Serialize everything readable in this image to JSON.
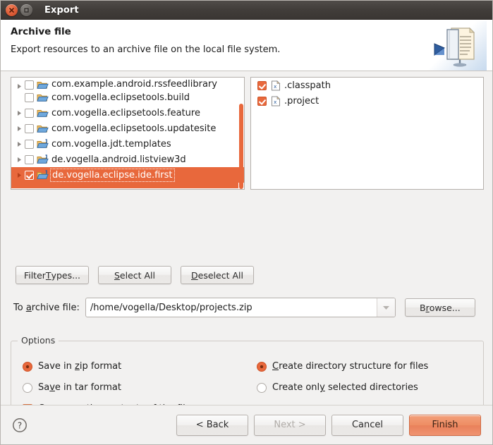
{
  "window": {
    "title": "Export",
    "close_icon": "close-icon",
    "maximize_icon": "maximize-icon"
  },
  "banner": {
    "title": "Archive file",
    "description": "Export resources to an archive file on the local file system.",
    "icon": "export-archive-banner-icon"
  },
  "resource_tree": {
    "scrollbar_color": "#e8683c",
    "selection_color": "#e8683c",
    "items": [
      {
        "label": "com.example.android.rssfeedlibrary",
        "checked": false,
        "expandable": true,
        "selected": false,
        "icon": "folder-icon",
        "clipped": true
      },
      {
        "label": "com.vogella.eclipsetools.build",
        "checked": false,
        "expandable": false,
        "selected": false,
        "icon": "folder-icon",
        "clipped": false
      },
      {
        "label": "com.vogella.eclipsetools.feature",
        "checked": false,
        "expandable": true,
        "selected": false,
        "icon": "folder-icon",
        "clipped": false
      },
      {
        "label": "com.vogella.eclipsetools.updatesite",
        "checked": false,
        "expandable": true,
        "selected": false,
        "icon": "folder-icon",
        "clipped": false
      },
      {
        "label": "com.vogella.jdt.templates",
        "checked": false,
        "expandable": true,
        "selected": false,
        "icon": "java-folder-icon",
        "clipped": false
      },
      {
        "label": "de.vogella.android.listview3d",
        "checked": false,
        "expandable": true,
        "selected": false,
        "icon": "java-folder-icon",
        "clipped": false
      },
      {
        "label": "de.vogella.eclipse.ide.first",
        "checked": true,
        "expandable": true,
        "selected": true,
        "icon": "java-folder-icon",
        "clipped": false
      }
    ]
  },
  "resource_files": {
    "items": [
      {
        "label": ".classpath",
        "checked": true,
        "icon": "xml-file-icon"
      },
      {
        "label": ".project",
        "checked": true,
        "icon": "xml-file-icon"
      }
    ]
  },
  "filter_buttons": [
    {
      "name": "filter-types-button",
      "pre": "Filter ",
      "mnemonic": "T",
      "post": "ypes..."
    },
    {
      "name": "select-all-button",
      "pre": "",
      "mnemonic": "S",
      "post": "elect All"
    },
    {
      "name": "deselect-all-button",
      "pre": "",
      "mnemonic": "D",
      "post": "eselect All"
    }
  ],
  "archive": {
    "label_pre": "To ",
    "label_mnemonic": "a",
    "label_post": "rchive file:",
    "value": "/home/vogella/Desktop/projects.zip",
    "placeholder": "",
    "dropdown_icon": "chevron-down-icon",
    "browse_pre": "B",
    "browse_mnemonic": "r",
    "browse_post": "owse..."
  },
  "options": {
    "group_title": "Options",
    "left": [
      {
        "type": "radio",
        "name": "save-zip-radio",
        "selected": true,
        "pre": "Save in ",
        "mnemonic": "z",
        "post": "ip format"
      },
      {
        "type": "radio",
        "name": "save-tar-radio",
        "selected": false,
        "pre": "Sa",
        "mnemonic": "v",
        "post": "e in tar format"
      },
      {
        "type": "checkbox",
        "name": "compress-checkbox",
        "selected": true,
        "pre": "Co",
        "mnemonic": "m",
        "post": "press the contents of the file"
      }
    ],
    "right": [
      {
        "type": "radio",
        "name": "create-directory-structure-radio",
        "selected": true,
        "pre": "",
        "mnemonic": "C",
        "post": "reate directory structure for files"
      },
      {
        "type": "radio",
        "name": "create-selected-directories-radio",
        "selected": false,
        "pre": "Create onl",
        "mnemonic": "y",
        "post": " selected directories"
      }
    ]
  },
  "footer": {
    "help_icon": "help-icon",
    "back": "< Back",
    "next": "Next >",
    "next_disabled": true,
    "cancel": "Cancel",
    "finish": "Finish",
    "finish_color": "#ee8d63"
  }
}
